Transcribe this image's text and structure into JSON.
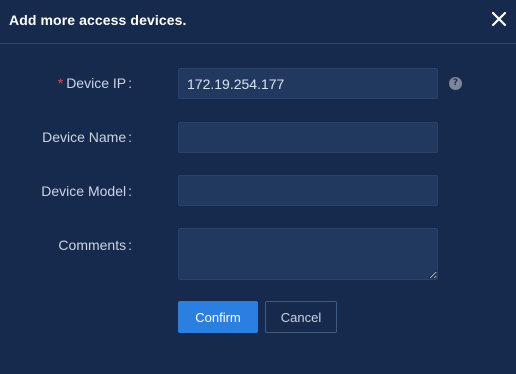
{
  "dialog": {
    "title": "Add more access devices."
  },
  "form": {
    "device_ip": {
      "required_mark": "*",
      "label": "Device IP",
      "colon": ":",
      "value": "172.19.254.177",
      "help": "?"
    },
    "device_name": {
      "label": "Device Name",
      "colon": ":",
      "value": ""
    },
    "device_model": {
      "label": "Device Model",
      "colon": ":",
      "value": ""
    },
    "comments": {
      "label": "Comments",
      "colon": ":",
      "value": ""
    }
  },
  "actions": {
    "confirm_label": "Confirm",
    "cancel_label": "Cancel"
  },
  "colors": {
    "background": "#162a4e",
    "field": "#22395f",
    "accent": "#2a7fe0",
    "required": "#e0444c"
  },
  "icons": {
    "close": "close-icon",
    "help": "help-icon"
  }
}
